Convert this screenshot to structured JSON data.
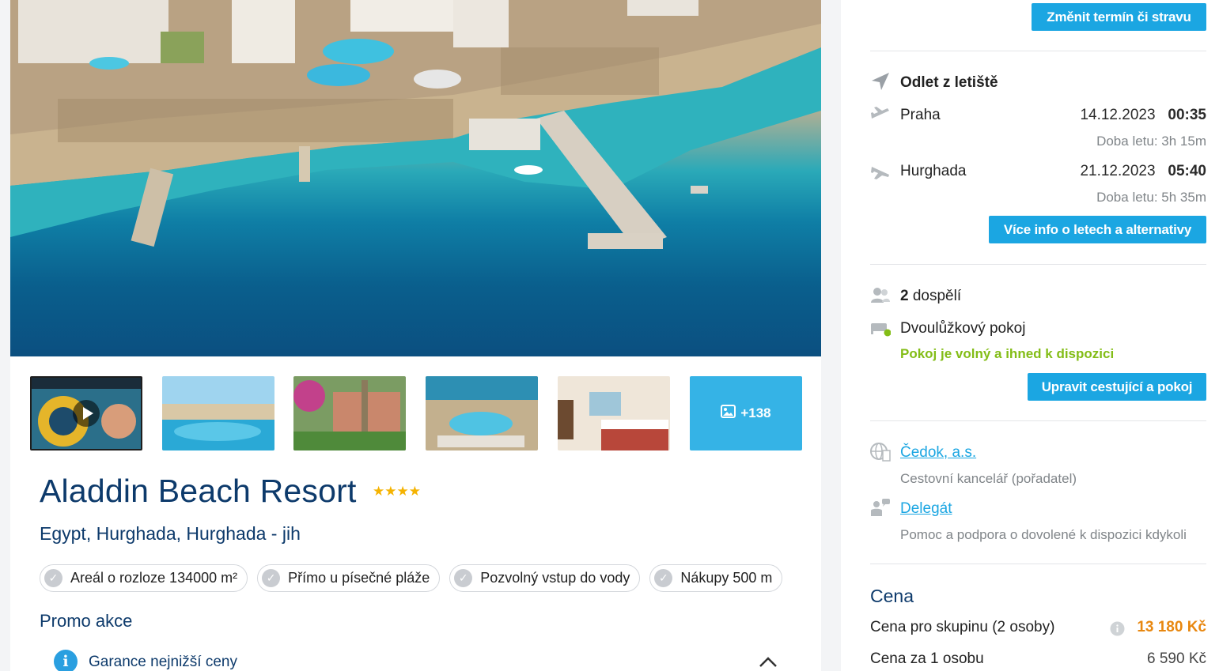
{
  "hotel": {
    "name": "Aladdin Beach Resort",
    "stars": "★★★★",
    "location": "Egypt, Hurghada, Hurghada - jih"
  },
  "gallery": {
    "more_label": "+138"
  },
  "features": [
    {
      "label": "Areál o rozloze 134000 m²"
    },
    {
      "label": "Přímo u písečné pláže"
    },
    {
      "label": "Pozvolný vstup do vody"
    },
    {
      "label": "Nákupy 500 m"
    }
  ],
  "promo": {
    "title": "Promo akce",
    "item_label": "Garance nejnižší ceny",
    "info_glyph": "i"
  },
  "sidebar": {
    "change_button": "Změnit termín či stravu",
    "departure_title": "Odlet z letiště",
    "outbound": {
      "city": "Praha",
      "date": "14.12.2023",
      "time": "00:35",
      "duration": "Doba letu: 3h 15m"
    },
    "return": {
      "city": "Hurghada",
      "date": "21.12.2023",
      "time": "05:40",
      "duration": "Doba letu: 5h 35m"
    },
    "flights_button": "Více info o letech a alternativy",
    "travellers_count": "2",
    "travellers_label": "dospělí",
    "room_type": "Dvoulůžkový pokoj",
    "room_availability": "Pokoj je volný a ihned k dispozici",
    "edit_button": "Upravit cestující a pokoj",
    "operator": {
      "name": "Čedok, a.s.",
      "description": "Cestovní kancelář (pořadatel)"
    },
    "delegate": {
      "name": "Delegát",
      "description": "Pomoc a podpora o dovolené k dispozici kdykoli"
    },
    "price": {
      "title": "Cena",
      "group_label": "Cena pro skupinu (2 osoby)",
      "group_value": "13 180 Kč",
      "person_label": "Cena za 1 osobu",
      "person_value": "6 590 Kč"
    }
  },
  "colors": {
    "accent": "#1ba6e2",
    "heading": "#0d3a6b",
    "available": "#83bd17",
    "price": "#e8870f"
  }
}
